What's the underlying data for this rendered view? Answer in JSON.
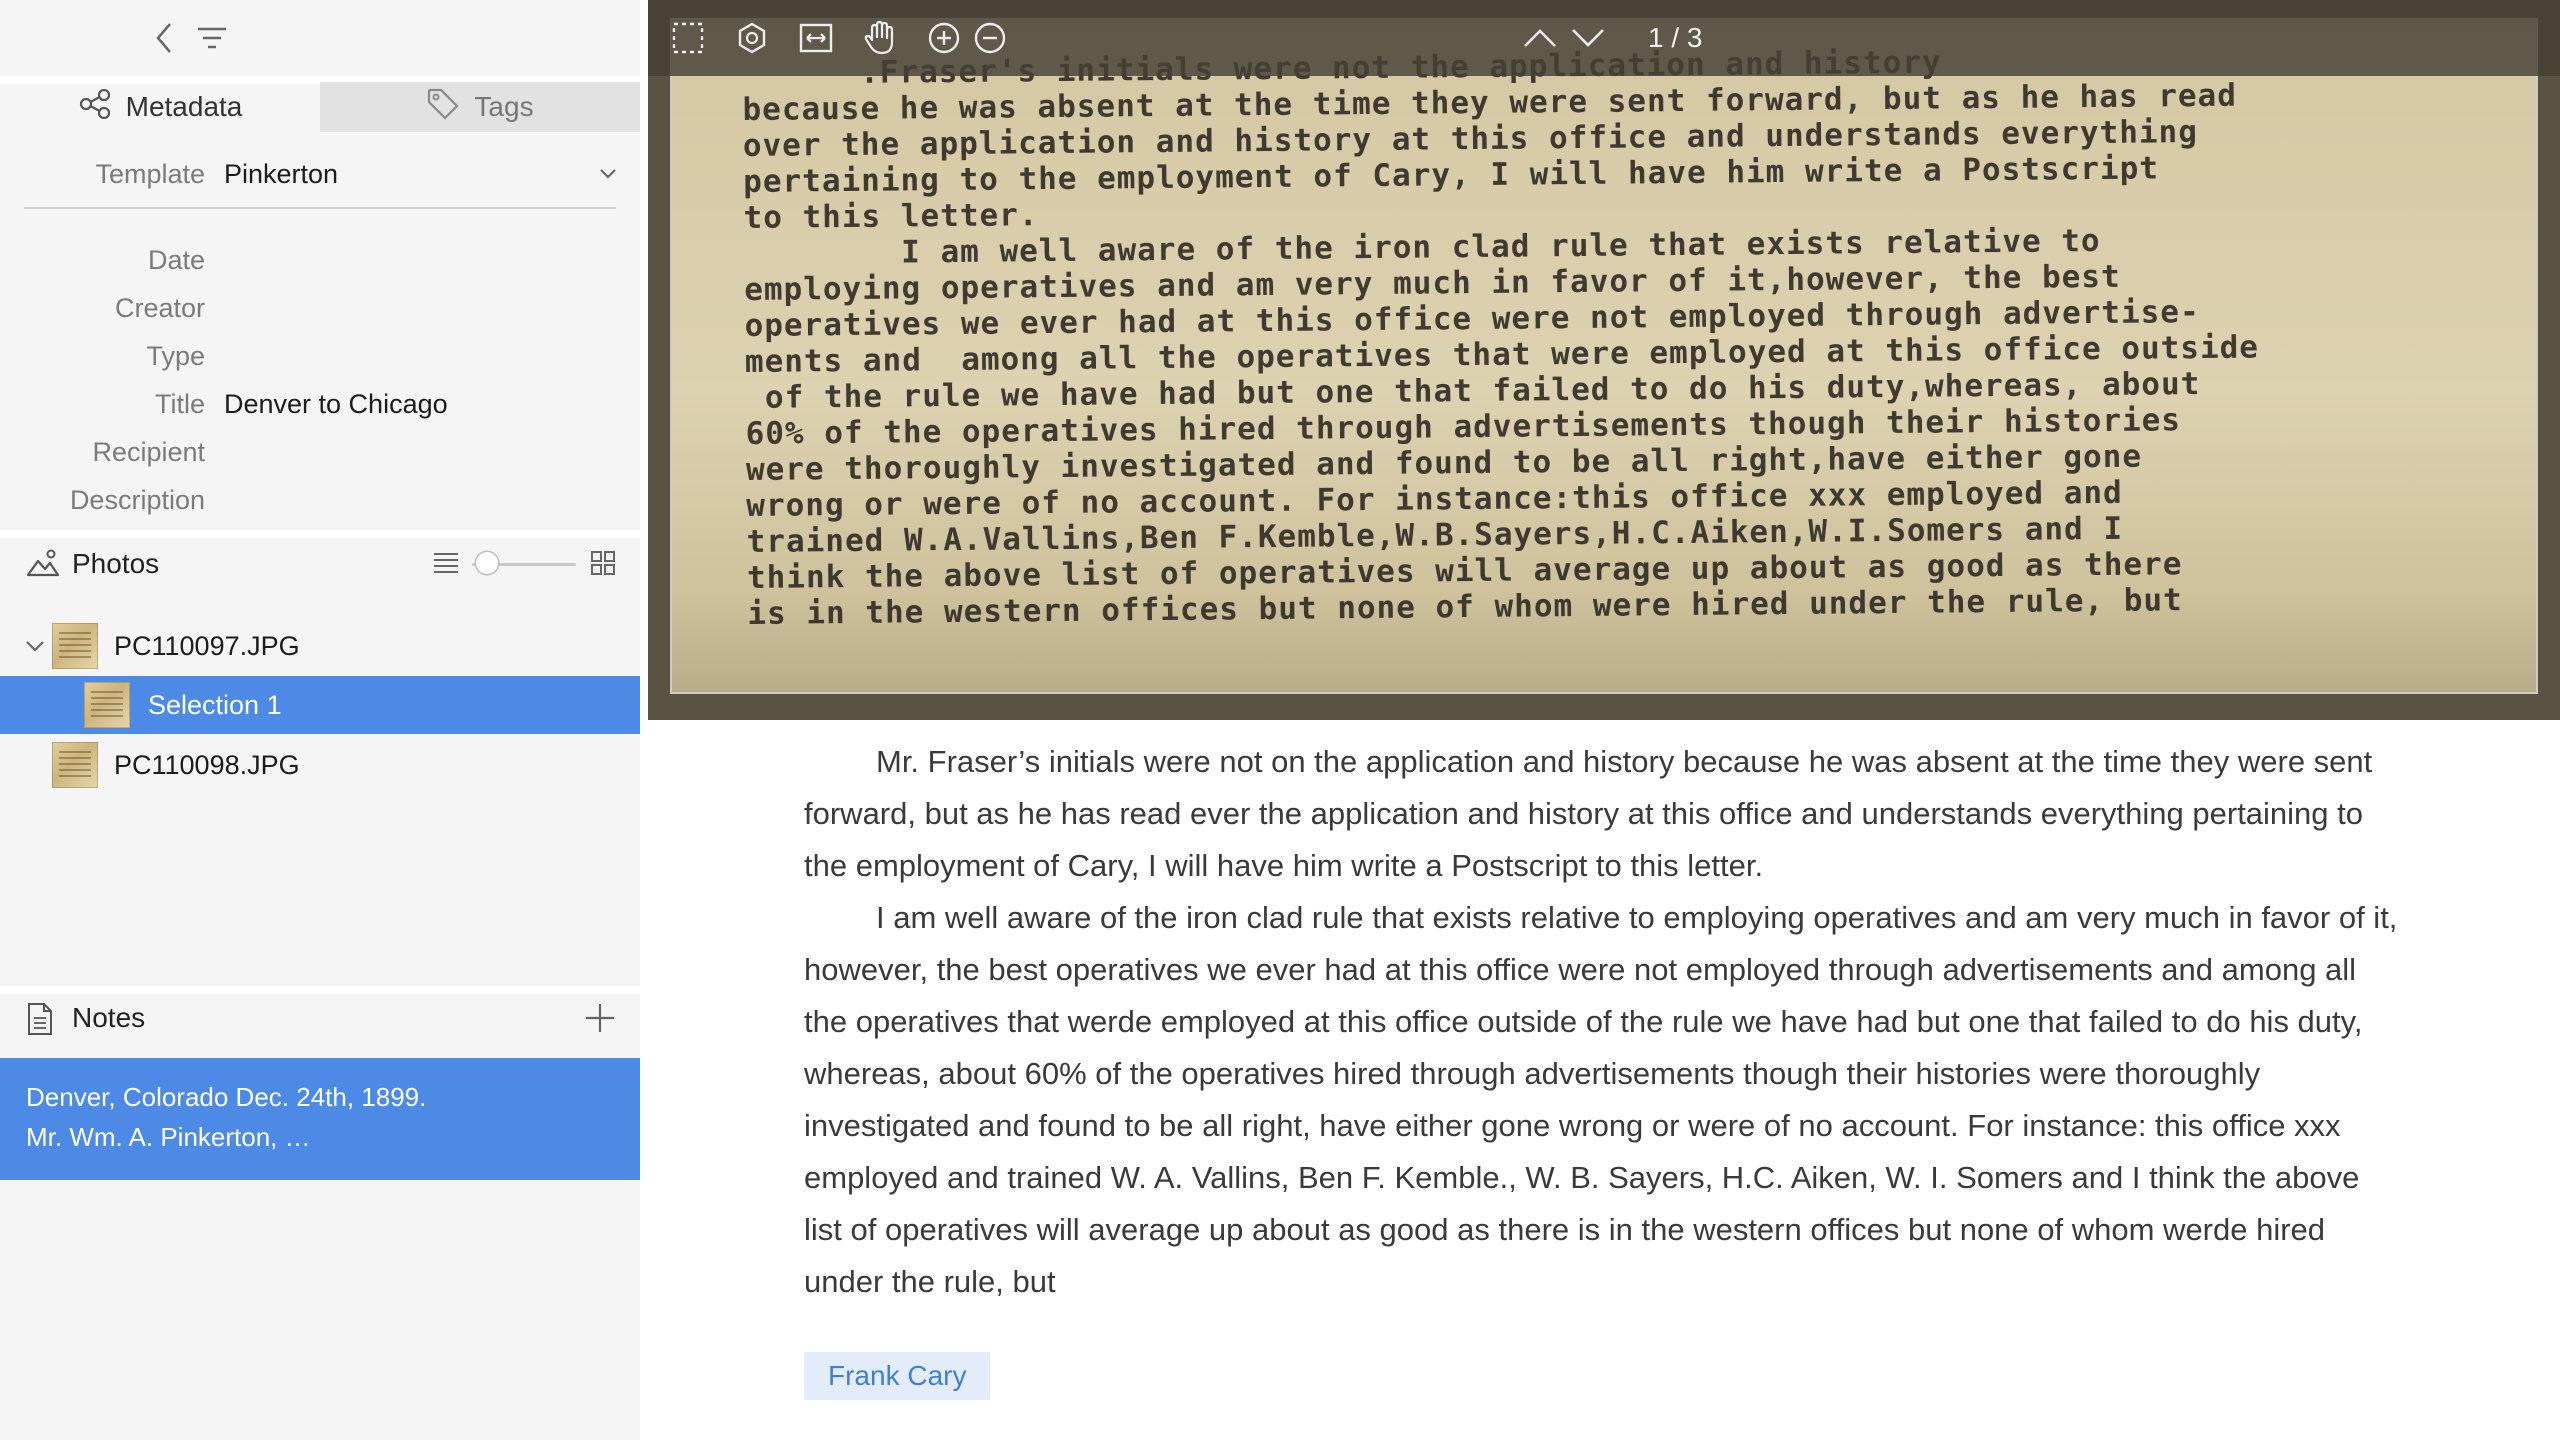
{
  "sidebar": {
    "tabs": [
      {
        "label": "Metadata",
        "icon": "share-icon"
      },
      {
        "label": "Tags",
        "icon": "tag-icon"
      }
    ],
    "template": {
      "label": "Template",
      "value": "Pinkerton"
    },
    "fields": [
      {
        "label": "Date",
        "value": ""
      },
      {
        "label": "Creator",
        "value": ""
      },
      {
        "label": "Type",
        "value": ""
      },
      {
        "label": "Title",
        "value": "Denver to Chicago"
      },
      {
        "label": "Recipient",
        "value": ""
      },
      {
        "label": "Description",
        "value": ""
      }
    ],
    "photos": {
      "title": "Photos",
      "zoom_fraction": 0.05,
      "items": [
        {
          "name": "PC110097.JPG",
          "expanded": true
        },
        {
          "name": "Selection 1",
          "selected": true
        },
        {
          "name": "PC110098.JPG"
        }
      ]
    },
    "notes": {
      "title": "Notes",
      "items": [
        {
          "line1": "Denver, Colorado Dec. 24th, 1899.",
          "line2": "Mr. Wm. A. Pinkerton, …"
        }
      ]
    }
  },
  "viewer": {
    "page_counter": "1 / 3",
    "doc_lines": [
      "      .Fraser's initials were not the application and history",
      "because he was absent at the time they were sent forward, but as he has read",
      "over the application and history at this office and understands everything",
      "pertaining to the employment of Cary, I will have him write a Postscript",
      "to this letter.",
      "        I am well aware of the iron clad rule that exists relative to",
      "employing operatives and am very much in favor of it,however, the best",
      "operatives we ever had at this office were not employed through advertise-",
      "ments and  among all the operatives that were employed at this office outside",
      " of the rule we have had but one that failed to do his duty,whereas, about",
      "60% of the operatives hired through advertisements though their histories",
      "were thoroughly investigated and found to be all right,have either gone",
      "wrong or were of no account. For instance:this office xxx employed and",
      "trained W.A.Vallins,Ben F.Kemble,W.B.Sayers,H.C.Aiken,W.I.Somers and I",
      "think the above list of operatives will average up about as good as there",
      "is in the western offices but none of whom were hired under the rule, but"
    ]
  },
  "transcript": {
    "paragraphs": [
      "Mr. Fraser’s initials were not on the application and history because he was absent at the time they were sent forward, but as he has read ever the application and history at this office and understands everything per­taining to the employment of Cary, I will have him write a Postscript to this letter.",
      "I am well aware of the iron clad rule that exists relative to employing operatives and am very much in favor of it, however, the best operatives we ever had at this office were not employed through advertisements and among all the operatives that werde employed at this office outside of the rule we have had but one that failed to do his duty, whereas, about 60% of the operatives hired through advertisements though their histories were thoroughly investigated and found to be all right, have either gone wrong or were of no account. For instance: this office xxx employed and trained W. A. Vallins, Ben F. Kemble., W. B. Sayers, H.C. Aiken, W. I. Somers and I think the above list of operatives will average up about as good as there is in the western offices but none of whom werde hired under the rule, but"
    ],
    "tag": "Frank Cary"
  },
  "colors": {
    "accent": "#4d8ae6",
    "sidebar_bg": "#f5f5f5",
    "tag_bg": "#e2ecfb",
    "tag_text": "#3f7fd8"
  }
}
